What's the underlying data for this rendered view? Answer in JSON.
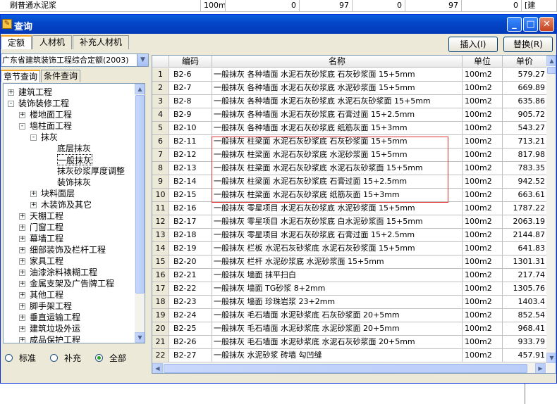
{
  "background_row": {
    "name": "刷普通水泥浆",
    "unit": "100m2",
    "v1": "0",
    "v2": "97",
    "v3": "0",
    "v4": "97",
    "v5": "0",
    "tag": "[建"
  },
  "window": {
    "title": "查询",
    "icon": "app-icon"
  },
  "tabs": [
    "定额",
    "人材机",
    "补充人材机"
  ],
  "buttons": {
    "insert": "插入(I)",
    "replace": "替换(R)"
  },
  "quota_select": {
    "value": "广东省建筑装饰工程综合定额(2003)"
  },
  "left_tabs": [
    "章节查询",
    "条件查询"
  ],
  "tree": [
    {
      "label": "建筑工程",
      "exp": "+",
      "level": 0
    },
    {
      "label": "装饰装修工程",
      "exp": "-",
      "level": 0
    },
    {
      "label": "楼地面工程",
      "exp": "+",
      "level": 1
    },
    {
      "label": "墙柱面工程",
      "exp": "-",
      "level": 1
    },
    {
      "label": "抹灰",
      "exp": "-",
      "level": 2
    },
    {
      "label": "底层抹灰",
      "exp": "",
      "level": 3
    },
    {
      "label": "一般抹灰",
      "exp": "",
      "level": 3,
      "selected": true
    },
    {
      "label": "抹灰砂浆厚度调整",
      "exp": "",
      "level": 3
    },
    {
      "label": "装饰抹灰",
      "exp": "",
      "level": 3
    },
    {
      "label": "块料面层",
      "exp": "+",
      "level": 2
    },
    {
      "label": "木装饰及其它",
      "exp": "+",
      "level": 2
    },
    {
      "label": "天棚工程",
      "exp": "+",
      "level": 1
    },
    {
      "label": "门窗工程",
      "exp": "+",
      "level": 1
    },
    {
      "label": "幕墙工程",
      "exp": "+",
      "level": 1
    },
    {
      "label": "细部装饰及栏杆工程",
      "exp": "+",
      "level": 1
    },
    {
      "label": "家具工程",
      "exp": "+",
      "level": 1
    },
    {
      "label": "油漆涂料裱糊工程",
      "exp": "+",
      "level": 1
    },
    {
      "label": "金属支架及广告牌工程",
      "exp": "+",
      "level": 1
    },
    {
      "label": "其他工程",
      "exp": "+",
      "level": 1
    },
    {
      "label": "脚手架工程",
      "exp": "+",
      "level": 1
    },
    {
      "label": "垂直运输工程",
      "exp": "+",
      "level": 1
    },
    {
      "label": "建筑垃圾外运",
      "exp": "+",
      "level": 1
    },
    {
      "label": "成品保护工程",
      "exp": "+",
      "level": 1
    }
  ],
  "radios": [
    {
      "label": "标准",
      "checked": false
    },
    {
      "label": "补充",
      "checked": false
    },
    {
      "label": "全部",
      "checked": true
    }
  ],
  "grid": {
    "headers": {
      "code": "编码",
      "name": "名称",
      "unit": "单位",
      "price": "单价"
    },
    "rows": [
      {
        "num": "1",
        "code": "B2-6",
        "name": "一般抹灰 各种墙面 水泥石灰砂浆底 石灰砂浆面 15+5mm",
        "unit": "100m2",
        "price": "579.27"
      },
      {
        "num": "2",
        "code": "B2-7",
        "name": "一般抹灰 各种墙面 水泥石灰砂浆底 水泥砂浆面 15+5mm",
        "unit": "100m2",
        "price": "669.89"
      },
      {
        "num": "3",
        "code": "B2-8",
        "name": "一般抹灰 各种墙面 水泥石灰砂浆底 水泥石灰砂浆面 15+5mm",
        "unit": "100m2",
        "price": "635.86"
      },
      {
        "num": "4",
        "code": "B2-9",
        "name": "一般抹灰 各种墙面 水泥石灰砂浆底 石膏过面 15+2.5mm",
        "unit": "100m2",
        "price": "905.72"
      },
      {
        "num": "5",
        "code": "B2-10",
        "name": "一般抹灰 各种墙面 水泥石灰砂浆底 纸筋灰面 15+3mm",
        "unit": "100m2",
        "price": "543.27"
      },
      {
        "num": "6",
        "code": "B2-11",
        "name": "一般抹灰 柱梁面 水泥石灰砂浆底 石灰砂浆面 15+5mm",
        "unit": "100m2",
        "price": "713.21"
      },
      {
        "num": "7",
        "code": "B2-12",
        "name": "一般抹灰 柱梁面 水泥石灰砂浆底 水泥砂浆面 15+5mm",
        "unit": "100m2",
        "price": "817.98"
      },
      {
        "num": "8",
        "code": "B2-13",
        "name": "一般抹灰 柱梁面 水泥石灰砂浆底 水泥石灰砂浆面 15+5mm",
        "unit": "100m2",
        "price": "783.35"
      },
      {
        "num": "9",
        "code": "B2-14",
        "name": "一般抹灰 柱梁面 水泥石灰砂浆底 石膏过面 15+2.5mm",
        "unit": "100m2",
        "price": "942.52"
      },
      {
        "num": "10",
        "code": "B2-15",
        "name": "一般抹灰 柱梁面 水泥石灰砂浆底 纸筋灰面 15+3mm",
        "unit": "100m2",
        "price": "663.61"
      },
      {
        "num": "11",
        "code": "B2-16",
        "name": "一般抹灰 零星项目 水泥石灰砂浆底 水泥砂浆面 15+5mm",
        "unit": "100m2",
        "price": "1787.22"
      },
      {
        "num": "12",
        "code": "B2-17",
        "name": "一般抹灰 零星项目 水泥石灰砂浆底 白水泥砂浆面 15+5mm",
        "unit": "100m2",
        "price": "2063.19"
      },
      {
        "num": "13",
        "code": "B2-18",
        "name": "一般抹灰 零星项目 水泥石灰砂浆底 石膏过面 15+2.5mm",
        "unit": "100m2",
        "price": "2144.87"
      },
      {
        "num": "14",
        "code": "B2-19",
        "name": "一般抹灰 栏板 水泥石灰砂浆底 水泥石灰砂浆面 15+5mm",
        "unit": "100m2",
        "price": "641.83"
      },
      {
        "num": "15",
        "code": "B2-20",
        "name": "一般抹灰 栏杆 水泥砂浆底 水泥砂浆面 15+5mm",
        "unit": "100m2",
        "price": "1301.31"
      },
      {
        "num": "16",
        "code": "B2-21",
        "name": "一般抹灰 墙面 抹平扫白",
        "unit": "100m2",
        "price": "217.74"
      },
      {
        "num": "17",
        "code": "B2-22",
        "name": "一般抹灰 墙面 TG砂浆 8+2mm",
        "unit": "100m2",
        "price": "1305.76"
      },
      {
        "num": "18",
        "code": "B2-23",
        "name": "一般抹灰 墙面 珍珠岩浆 23+2mm",
        "unit": "100m2",
        "price": "1403.4"
      },
      {
        "num": "19",
        "code": "B2-24",
        "name": "一般抹灰 毛石墙面 水泥砂浆底 石灰砂浆面 20+5mm",
        "unit": "100m2",
        "price": "852.54"
      },
      {
        "num": "20",
        "code": "B2-25",
        "name": "一般抹灰 毛石墙面 水泥砂浆底 水泥砂浆面 20+5mm",
        "unit": "100m2",
        "price": "968.41"
      },
      {
        "num": "21",
        "code": "B2-26",
        "name": "一般抹灰 毛石墙面 水泥砂浆底 水泥石灰砂浆面 20+5mm",
        "unit": "100m2",
        "price": "933.79"
      },
      {
        "num": "22",
        "code": "B2-27",
        "name": "一般抹灰 水泥砂浆 砖墙 勾凹缝",
        "unit": "100m2",
        "price": "457.91"
      }
    ]
  },
  "colors": {
    "titlebar": "#0447c9",
    "highlight_box": "#e03030",
    "tab_accent": "#f5a623"
  }
}
